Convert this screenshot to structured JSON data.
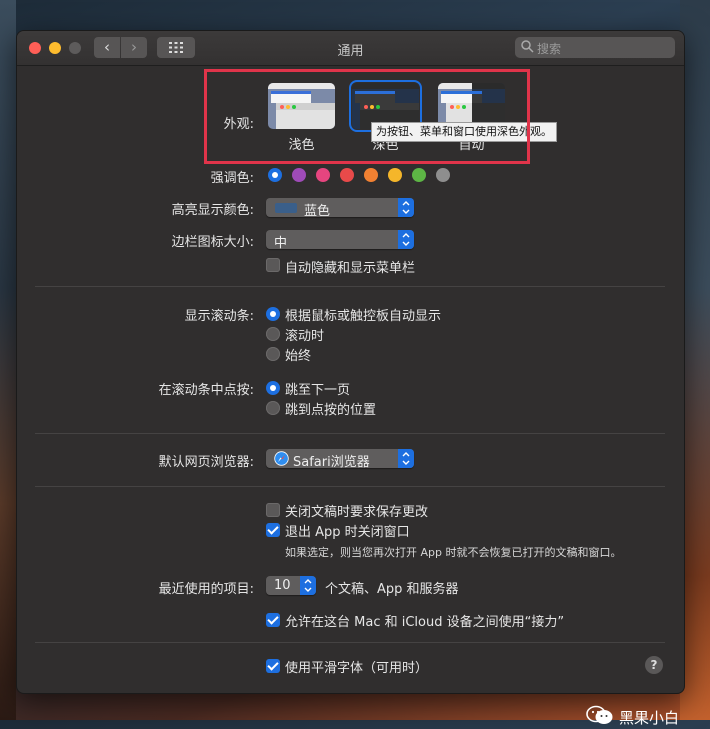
{
  "window": {
    "title": "通用",
    "search_placeholder": "搜索"
  },
  "appearance": {
    "label": "外观:",
    "options": [
      {
        "name": "浅色",
        "selected": false
      },
      {
        "name": "深色",
        "selected": true
      },
      {
        "name": "自动",
        "selected": false
      }
    ],
    "tooltip": "为按钮、菜单和窗口使用深色外观。"
  },
  "accent": {
    "label": "强调色:",
    "colors": [
      "#1d6fe0",
      "#9f4bb8",
      "#e6457f",
      "#e84a4a",
      "#f28132",
      "#f5b62a",
      "#5db545",
      "#8e8e8e"
    ]
  },
  "highlight": {
    "label": "高亮显示颜色:",
    "value": "蓝色",
    "swatch": "#3a5f8a"
  },
  "sidebar": {
    "label": "边栏图标大小:",
    "value": "中"
  },
  "menubar": {
    "label": "自动隐藏和显示菜单栏",
    "checked": false
  },
  "scrollbars": {
    "label": "显示滚动条:",
    "options": [
      {
        "label": "根据鼠标或触控板自动显示",
        "selected": true
      },
      {
        "label": "滚动时",
        "selected": false
      },
      {
        "label": "始终",
        "selected": false
      }
    ]
  },
  "click": {
    "label": "在滚动条中点按:",
    "options": [
      {
        "label": "跳至下一页",
        "selected": true
      },
      {
        "label": "跳到点按的位置",
        "selected": false
      }
    ]
  },
  "browser": {
    "label": "默认网页浏览器:",
    "value": "Safari浏览器"
  },
  "documents": {
    "ask_save": {
      "label": "关闭文稿时要求保存更改",
      "checked": false
    },
    "close_windows": {
      "label": "退出 App 时关闭窗口",
      "checked": true
    },
    "note": "如果选定，则当您再次打开 App 时就不会恢复已打开的文稿和窗口。"
  },
  "recent": {
    "label": "最近使用的项目:",
    "value": "10",
    "suffix": "个文稿、App 和服务器"
  },
  "handoff": {
    "label": "允许在这台 Mac 和 iCloud 设备之间使用“接力”",
    "checked": true
  },
  "smoothing": {
    "label": "使用平滑字体（可用时）",
    "checked": true
  },
  "help": "?",
  "brand": "黑果小白"
}
